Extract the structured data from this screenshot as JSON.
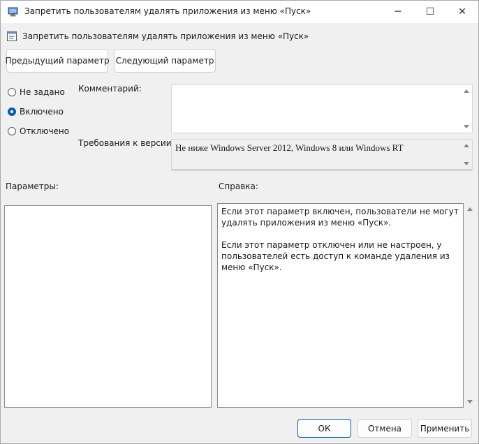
{
  "window": {
    "title": "Запретить пользователям удалять приложения из меню «Пуск»",
    "controls": {
      "minimize": "─",
      "maximize": "☐",
      "close": "✕"
    }
  },
  "policy": {
    "title": "Запретить пользователям удалять приложения из меню «Пуск»",
    "icon": "policy-setting-icon"
  },
  "nav": {
    "prev_label": "Предыдущий параметр",
    "next_label": "Следующий параметр"
  },
  "state": {
    "options": [
      {
        "label": "Не задано",
        "checked": false
      },
      {
        "label": "Включено",
        "checked": true
      },
      {
        "label": "Отключено",
        "checked": false
      }
    ]
  },
  "comment": {
    "label": "Комментарий:",
    "value": ""
  },
  "version": {
    "label": "Требования к версии:",
    "value": "Не ниже Windows Server 2012, Windows 8 или Windows RT"
  },
  "params": {
    "label": "Параметры:"
  },
  "help": {
    "label": "Справка:",
    "paragraphs": [
      "Если этот параметр включен, пользователи не могут удалять приложения из меню «Пуск».",
      "Если этот параметр отключен или не настроен, у пользователей есть доступ к команде удаления из меню «Пуск»."
    ]
  },
  "footer": {
    "ok_label": "ОК",
    "cancel_label": "Отмена",
    "apply_label": "Применить"
  },
  "colors": {
    "accent": "#005fb8",
    "background": "#f0f0f0"
  }
}
